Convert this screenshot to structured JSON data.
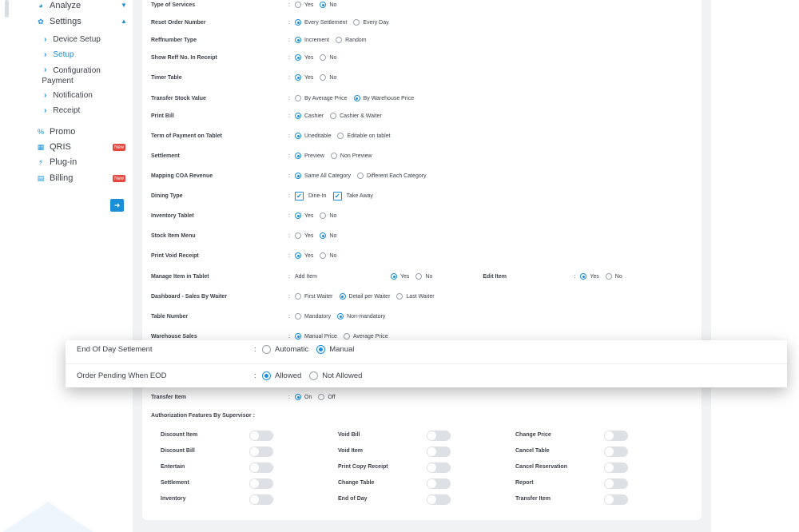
{
  "sidebar": {
    "analyze": "Analyze",
    "settings": "Settings",
    "sub": [
      "Device Setup",
      "Setup",
      "Configuration",
      "Payment",
      "Notification",
      "Receipt"
    ],
    "promo": "Promo",
    "qris": "QRIS",
    "plugin": "Plug-in",
    "billing": "Billing",
    "new_badge": "New"
  },
  "settings_rows": [
    {
      "label": "Type of Services",
      "options": [
        "Yes",
        "No"
      ],
      "selected": 1
    },
    {
      "label": "Reset Order Number",
      "options": [
        "Every Settlement",
        "Every Day"
      ],
      "selected": 0
    },
    {
      "label": "Reffnumber Type",
      "options": [
        "Increment",
        "Random"
      ],
      "selected": 0
    },
    {
      "label": "Show Reff No. In Receipt",
      "options": [
        "Yes",
        "No"
      ],
      "selected": 0
    },
    {
      "label": "Timer Table",
      "options": [
        "Yes",
        "No"
      ],
      "selected": 0
    },
    {
      "label": "Transfer Stock Value",
      "options": [
        "By Average Price",
        "By Warehouse Price"
      ],
      "selected": 1
    },
    {
      "label": "Print Bill",
      "options": [
        "Cashier",
        "Cashier & Waiter"
      ],
      "selected": 0
    },
    {
      "label": "Term of Payment on Tablet",
      "options": [
        "Uneditable",
        "Editable on tablet"
      ],
      "selected": 0
    },
    {
      "label": "Settlement",
      "options": [
        "Preview",
        "Non Preview"
      ],
      "selected": 0
    },
    {
      "label": "Mapping COA Revenue",
      "options": [
        "Same All Category",
        "Different Each Category"
      ],
      "selected": 0
    },
    {
      "label": "Dining Type",
      "checks": [
        "Dine-In",
        "Take Away"
      ]
    },
    {
      "label": "Inventory Tablet",
      "options": [
        "Yes",
        "No"
      ],
      "selected": 0
    },
    {
      "label": "Stock Item Menu",
      "options": [
        "Yes",
        "No"
      ],
      "selected": 1
    },
    {
      "label": "Print Void Receipt",
      "options": [
        "Yes",
        "No"
      ],
      "selected": 0
    },
    {
      "label": "Manage Item in Tablet",
      "add_item": "Add Item",
      "edit_item": "Edit Item",
      "options": [
        "Yes",
        "No"
      ]
    },
    {
      "label": "Dashboard - Sales By Waiter",
      "options": [
        "First Waiter",
        "Detail per Waiter",
        "Last Waiter"
      ],
      "selected": 1
    },
    {
      "label": "Table Number",
      "options": [
        "Mandatory",
        "Non-mandatory"
      ],
      "selected": 1
    },
    {
      "label": "Warehouse Sales",
      "options": [
        "Manual Price",
        "Average Price"
      ],
      "selected": 0
    },
    {
      "label": "Transfer Item",
      "options": [
        "On",
        "Off"
      ],
      "selected": 0
    }
  ],
  "colon": ":",
  "auth": {
    "title": "Authorization Features By Supervisor :",
    "col1": [
      "Discount Item",
      "Discount Bill",
      "Entertain",
      "Settlement",
      "Inventory"
    ],
    "col2": [
      "Void Bill",
      "Void Item",
      "Print Copy Receipt",
      "Change Table",
      "End of Day"
    ],
    "col3": [
      "Change Price",
      "Cancel Table",
      "Cancel Reservation",
      "Report",
      "Transfer Item"
    ]
  },
  "overlay": {
    "row1": {
      "label": "End Of Day Setlement",
      "options": [
        "Automatic",
        "Manual"
      ],
      "selected": 1
    },
    "row2": {
      "label": "Order Pending When EOD",
      "options": [
        "Allowed",
        "Not Allowed"
      ],
      "selected": 0
    }
  },
  "colors": {
    "accent": "#1a8fd8",
    "badge": "#e8453c"
  }
}
